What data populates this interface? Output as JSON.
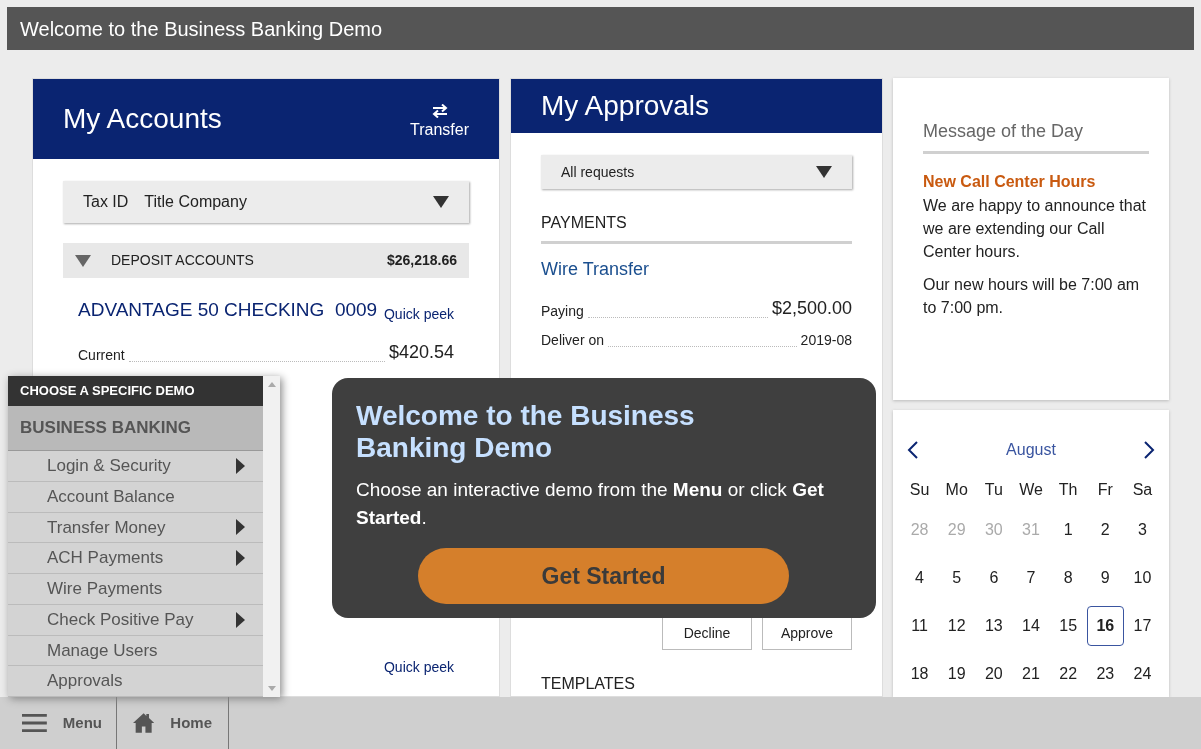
{
  "top_bar": {
    "title": "Welcome to the Business Banking Demo"
  },
  "accounts_panel": {
    "title": "My Accounts",
    "transfer_label": "Transfer",
    "select": {
      "label": "Tax ID",
      "value": "Title Company"
    },
    "group": {
      "name": "DEPOSIT ACCOUNTS",
      "total": "$26,218.66",
      "expanded": true
    },
    "account": {
      "name": "ADVANTAGE 50 CHECKING  0009",
      "link": "Quick peek",
      "rows": [
        {
          "label": "Current",
          "value": "$420.54"
        }
      ]
    },
    "bottom_link": "Quick peek"
  },
  "approvals_panel": {
    "title": "My Approvals",
    "select": {
      "value": "All requests"
    },
    "section": "PAYMENTS",
    "item": {
      "name": "Wire Transfer",
      "rows": [
        {
          "label": "Paying",
          "value": "$2,500.00",
          "kind": "large"
        },
        {
          "label": "Deliver on",
          "value": "2019-08",
          "kind": "small"
        }
      ]
    },
    "buttons": [
      "Decline",
      "Approve"
    ],
    "next_section": "TEMPLATES"
  },
  "message": {
    "title": "Message of the Day",
    "headline": "New Call Center Hours",
    "paragraphs": [
      "We are happy to announce that we are extending our Call Center hours.",
      "Our new hours will be 7:00 am to 7:00 pm."
    ]
  },
  "calendar": {
    "month": "August",
    "weekdays": [
      "Su",
      "Mo",
      "Tu",
      "We",
      "Th",
      "Fr",
      "Sa"
    ],
    "days": [
      {
        "label": "28",
        "muted": true,
        "selected": false
      },
      {
        "label": "29",
        "muted": true,
        "selected": false
      },
      {
        "label": "30",
        "muted": true,
        "selected": false
      },
      {
        "label": "31",
        "muted": true,
        "selected": false
      },
      {
        "label": "1",
        "muted": false,
        "selected": false
      },
      {
        "label": "2",
        "muted": false,
        "selected": false
      },
      {
        "label": "3",
        "muted": false,
        "selected": false
      },
      {
        "label": "4",
        "muted": false,
        "selected": false
      },
      {
        "label": "5",
        "muted": false,
        "selected": false
      },
      {
        "label": "6",
        "muted": false,
        "selected": false
      },
      {
        "label": "7",
        "muted": false,
        "selected": false
      },
      {
        "label": "8",
        "muted": false,
        "selected": false
      },
      {
        "label": "9",
        "muted": false,
        "selected": false
      },
      {
        "label": "10",
        "muted": false,
        "selected": false
      },
      {
        "label": "11",
        "muted": false,
        "selected": false
      },
      {
        "label": "12",
        "muted": false,
        "selected": false
      },
      {
        "label": "13",
        "muted": false,
        "selected": false
      },
      {
        "label": "14",
        "muted": false,
        "selected": false
      },
      {
        "label": "15",
        "muted": false,
        "selected": false
      },
      {
        "label": "16",
        "muted": false,
        "selected": true
      },
      {
        "label": "17",
        "muted": false,
        "selected": false
      },
      {
        "label": "18",
        "muted": false,
        "selected": false
      },
      {
        "label": "19",
        "muted": false,
        "selected": false
      },
      {
        "label": "20",
        "muted": false,
        "selected": false
      },
      {
        "label": "21",
        "muted": false,
        "selected": false
      },
      {
        "label": "22",
        "muted": false,
        "selected": false
      },
      {
        "label": "23",
        "muted": false,
        "selected": false
      },
      {
        "label": "24",
        "muted": false,
        "selected": false
      }
    ]
  },
  "demo_menu": {
    "header": "CHOOSE A SPECIFIC DEMO",
    "section": "BUSINESS BANKING",
    "items": [
      {
        "label": "Login & Security",
        "submenu": true
      },
      {
        "label": "Account Balance",
        "submenu": false
      },
      {
        "label": "Transfer Money",
        "submenu": true
      },
      {
        "label": "ACH Payments",
        "submenu": true
      },
      {
        "label": "Wire Payments",
        "submenu": false
      },
      {
        "label": "Check Positive Pay",
        "submenu": true
      },
      {
        "label": "Manage Users",
        "submenu": false
      },
      {
        "label": "Approvals",
        "submenu": false
      }
    ]
  },
  "welcome": {
    "title": "Welcome to the Business Banking Demo",
    "body": "Choose an interactive demo from the **Menu** or click **Get Started**.",
    "button": "Get Started"
  },
  "bottom_bar": {
    "items": [
      {
        "label": "Menu",
        "kind": "menu"
      },
      {
        "label": "Home",
        "kind": "home"
      }
    ]
  }
}
